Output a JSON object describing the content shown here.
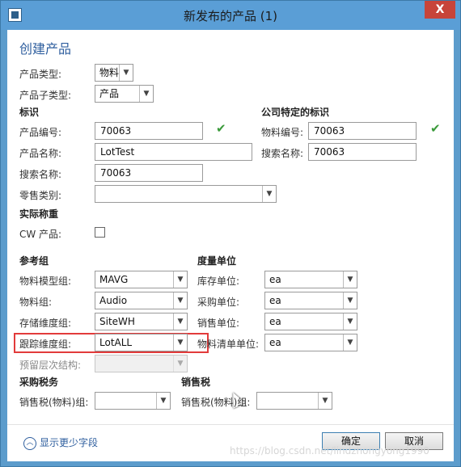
{
  "window": {
    "title": "新发布的产品 (1)",
    "close_symbol": "X"
  },
  "heading": "创建产品",
  "fields": {
    "product_type": {
      "label": "产品类型:",
      "value": "物料"
    },
    "product_subtype": {
      "label": "产品子类型:",
      "value": "产品"
    },
    "product_number": {
      "label": "产品编号:",
      "value": "70063"
    },
    "product_name": {
      "label": "产品名称:",
      "value": "LotTest"
    },
    "search_name": {
      "label": "搜索名称:",
      "value": "70063"
    },
    "retail_category": {
      "label": "零售类别:",
      "value": ""
    },
    "item_number": {
      "label": "物料编号:",
      "value": "70063"
    },
    "item_search_name": {
      "label": "搜索名称:",
      "value": "70063"
    },
    "cw_product": {
      "label": "CW 产品:"
    }
  },
  "sections": {
    "identification": "标识",
    "company_identification": "公司特定的标识",
    "actual_weight": "实际称重",
    "reference_group": "参考组",
    "units": "度量单位",
    "purchase_tax": "采购税务",
    "sales_tax": "销售税"
  },
  "reference_group": {
    "item_model_group": {
      "label": "物料模型组:",
      "value": "MAVG"
    },
    "item_group": {
      "label": "物料组:",
      "value": "Audio"
    },
    "storage_dimension_group": {
      "label": "存储维度组:",
      "value": "SiteWH"
    },
    "tracking_dimension_group": {
      "label": "跟踪维度组:",
      "value": "LotALL"
    },
    "reserve_hierarchy": {
      "label": "预留层次结构:",
      "value": ""
    }
  },
  "units": {
    "inventory_unit": {
      "label": "库存单位:",
      "value": "ea"
    },
    "purchase_unit": {
      "label": "采购单位:",
      "value": "ea"
    },
    "sales_unit": {
      "label": "销售单位:",
      "value": "ea"
    },
    "bom_unit": {
      "label": "物料清单单位:",
      "value": "ea"
    }
  },
  "taxes": {
    "purchase_tax_group": {
      "label": "销售税(物料)组:",
      "value": ""
    },
    "sales_tax_group": {
      "label": "销售税(物料)组:",
      "value": ""
    }
  },
  "footer": {
    "show_fewer": "显示更少字段",
    "ok": "确定",
    "cancel": "取消",
    "watermark": "https://blog.csdn.net/lindzhongyong1990"
  },
  "colors": {
    "accent": "#2e5e9e",
    "check": "#3a9a3a",
    "highlight": "#e23b3b",
    "titlebar": "#5a9ed6"
  }
}
